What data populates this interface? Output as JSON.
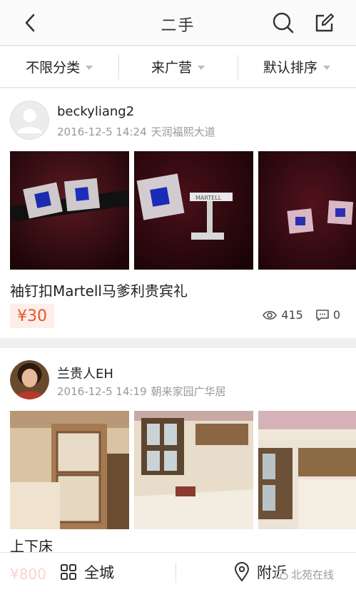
{
  "header": {
    "title": "二手",
    "back_icon": "chevron-left-icon",
    "search_icon": "search-icon",
    "compose_icon": "compose-icon"
  },
  "filters": [
    {
      "label": "不限分类"
    },
    {
      "label": "来广营"
    },
    {
      "label": "默认排序"
    }
  ],
  "posts": [
    {
      "user": "beckyliang2",
      "date": "2016-12-5 14:24",
      "location": "天润福熙大道",
      "title": "袖钉扣Martell马爹利贵宾礼",
      "price": "¥30",
      "views": "415",
      "comments": "0",
      "photo_colors": [
        "#3a0f14",
        "#2a0a0f",
        "#3d0d18"
      ]
    },
    {
      "user": "兰贵人EH",
      "date": "2016-12-5 14:19",
      "location": "朝来家园广华居",
      "title": "上下床",
      "price": "¥800",
      "photo_colors": [
        "#c9a77f",
        "#d6c1a6",
        "#c8b59d"
      ]
    }
  ],
  "bottom_nav": {
    "all_city": "全城",
    "nearby": "附近"
  },
  "watermark": "北苑在线",
  "colors": {
    "accent": "#e8542f",
    "price_bg": "#fdeeea"
  }
}
